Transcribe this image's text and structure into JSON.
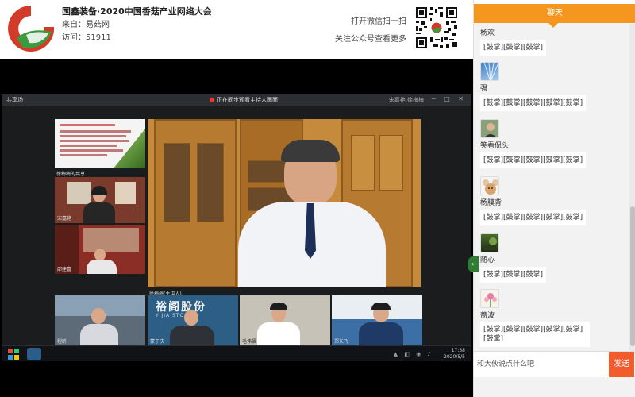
{
  "header": {
    "title": "国鑫装备·2020中国香菇产业网络大会",
    "source_label": "来自：",
    "source_value": "易菇网",
    "views_label": "访问：",
    "views_value": "51911",
    "wechat_scan": "打开微信扫一扫",
    "follow_more": "关注公众号查看更多"
  },
  "video": {
    "share_label": "共享场",
    "status_text": "正在同步观看主持人画面",
    "right_label": "宋嘉艳,徐梅梅",
    "participants": {
      "shared": "徐梅梅的共享",
      "p1": "宋嘉艳",
      "p2": "邵建富",
      "main": "徐梅梅(主讲人)",
      "b1": "程昕",
      "b2": "蒙于庆",
      "b3": "毛伟福",
      "b4": "郑长飞"
    },
    "tile_banner_text": "YIJIA STOCK",
    "tile_banner_cn": "裕阁股份",
    "clock": "17:38",
    "date": "2020/5/5"
  },
  "chat": {
    "tab_label": "聊天",
    "messages": [
      {
        "user": "杨欢",
        "text": "[鼓掌][鼓掌][鼓掌]",
        "avatar": "none-avatar"
      },
      {
        "user": "强",
        "text": "[鼓掌][鼓掌][鼓掌][鼓掌][鼓掌]",
        "avatar": "sky-avatar"
      },
      {
        "user": "笑看侃头",
        "text": "[鼓掌][鼓掌][鼓掌][鼓掌][鼓掌]",
        "avatar": "person-avatar"
      },
      {
        "user": "杨膜背",
        "text": "[鼓掌][鼓掌][鼓掌][鼓掌][鼓掌]",
        "avatar": "mouse-avatar"
      },
      {
        "user": "随心",
        "text": "[鼓掌][鼓掌][鼓掌]",
        "avatar": "nature-avatar"
      },
      {
        "user": "蔷波",
        "text": "[鼓掌][鼓掌][鼓掌][鼓掌][鼓掌][鼓掌]",
        "avatar": "flower-avatar"
      }
    ],
    "input_placeholder": "和大伙说点什么吧",
    "send_label": "发送"
  },
  "colors": {
    "chat_tab": "#f5961e",
    "send_button": "#f25c2c",
    "logo_red": "#d23a2a",
    "logo_green": "#3a9a3c"
  }
}
